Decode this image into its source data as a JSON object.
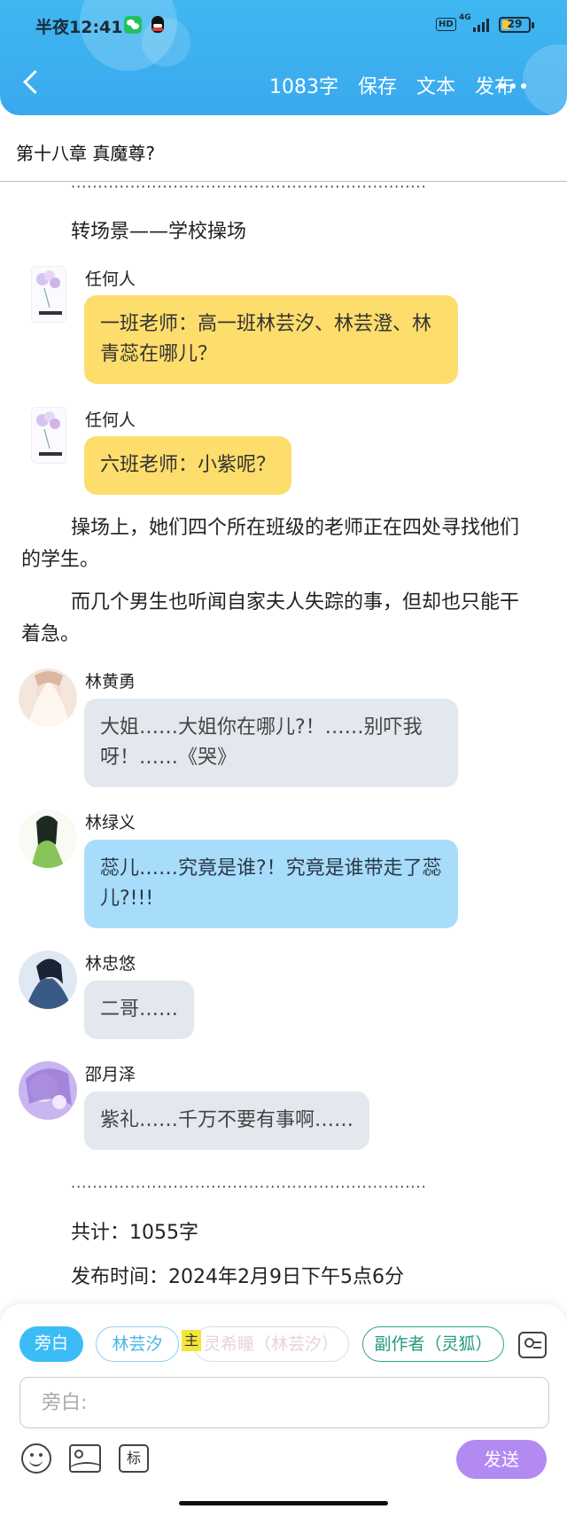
{
  "status_bar": {
    "time": "半夜12:41",
    "hd": "HD",
    "network": "4G",
    "battery": "29"
  },
  "toolbar": {
    "word_count": "1083字",
    "save": "保存",
    "text": "文本",
    "publish": "发布"
  },
  "chapter": {
    "title": "第十八章 真魔尊?"
  },
  "content": {
    "dots_top": "··································································",
    "scene": "转场景——学校操场",
    "messages": [
      {
        "speaker": "任何人",
        "text": "一班老师：高一班林芸汐、林芸澄、林青蕊在哪儿？"
      },
      {
        "speaker": "任何人",
        "text": "六班老师：小紫呢？"
      }
    ],
    "para1": "操场上，她们四个所在班级的老师正在四处寻找他们的学生。",
    "para2": "而几个男生也听闻自家夫人失踪的事，但却也只能干着急。",
    "messages2": [
      {
        "speaker": "林黄勇",
        "text": "大姐……大姐你在哪儿?！……别吓我呀！……《哭》"
      },
      {
        "speaker": "林绿义",
        "text": "蕊儿……究竟是谁?！究竟是谁带走了蕊儿?!!!"
      },
      {
        "speaker": "林忠悠",
        "text": "二哥……"
      },
      {
        "speaker": "邵月泽",
        "text": "紫礼……千万不要有事啊……"
      }
    ],
    "dots_bottom": "··································································",
    "total": "共计：1055字",
    "publish_time": "发布时间：2024年2月9日下午5点6分"
  },
  "composer": {
    "chips": [
      "旁白",
      "林芸汐",
      "灵希瞳（林芸汐）",
      "副作者（灵狐）"
    ],
    "main_badge": "主",
    "placeholder": "旁白:",
    "tag_label": "标",
    "send": "发送"
  },
  "colors": {
    "header": "#3aa9ee",
    "yellow_bubble": "#fddd6c",
    "blue_bubble": "#a8dcfb",
    "gray_bubble": "#e3e8ef",
    "send": "#b38af2"
  }
}
